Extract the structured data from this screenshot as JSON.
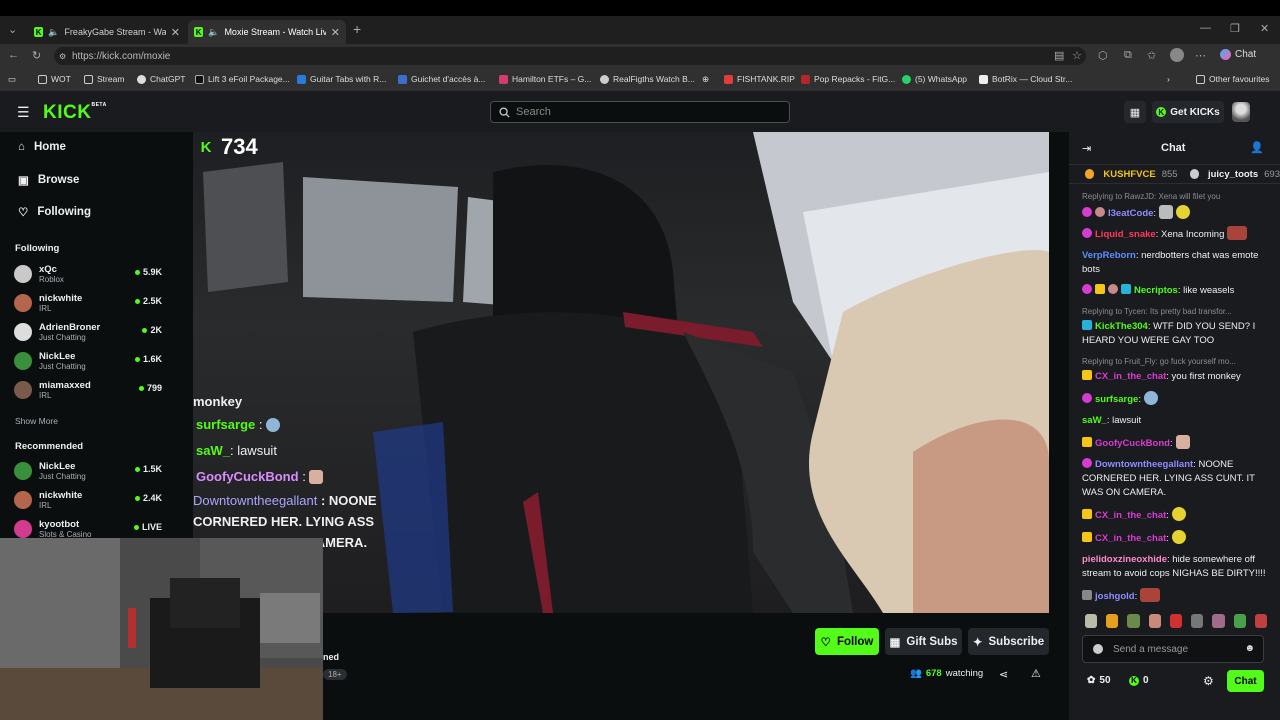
{
  "browser": {
    "tabs": [
      {
        "title": "FreakyGabe Stream - Watch L",
        "active": false
      },
      {
        "title": "Moxie Stream - Watch Live o",
        "active": true
      }
    ],
    "url": "https://kick.com/moxie",
    "assistant_label": "Chat",
    "bookmarks": [
      "WOT",
      "Stream",
      "ChatGPT",
      "Lift 3 eFoil Package...",
      "Guitar Tabs with R...",
      "Guichet d'accès à...",
      "Hamilton ETFs – G...",
      "RealFigths Watch B...",
      "FISHTANK.RIP",
      "Pop Repacks - FitG...",
      "(5) WhatsApp",
      "BotRix — Cloud Str..."
    ],
    "other_bookmarks": "Other favourites"
  },
  "header": {
    "logo": "KICK",
    "logo_badge": "BETA",
    "search_placeholder": "Search",
    "get_kicks": "Get KICKs"
  },
  "sidebar": {
    "nav": [
      "Home",
      "Browse",
      "Following"
    ],
    "following_title": "Following",
    "following": [
      {
        "name": "xQc",
        "category": "Roblox",
        "viewers": "5.9K",
        "color": "#c9c9c9"
      },
      {
        "name": "nickwhite",
        "category": "IRL",
        "viewers": "2.5K",
        "color": "#b5654b"
      },
      {
        "name": "AdrienBroner",
        "category": "Just Chatting",
        "viewers": "2K",
        "color": "#ddd"
      },
      {
        "name": "NickLee",
        "category": "Just Chatting",
        "viewers": "1.6K",
        "color": "#3a8f3a"
      },
      {
        "name": "miamaxxed",
        "category": "IRL",
        "viewers": "799",
        "color": "#7a5a4a"
      }
    ],
    "show_more": "Show More",
    "recommended_title": "Recommended",
    "recommended": [
      {
        "name": "NickLee",
        "category": "Just Chatting",
        "viewers": "1.5K",
        "color": "#3a8f3a"
      },
      {
        "name": "nickwhite",
        "category": "IRL",
        "viewers": "2.4K",
        "color": "#b5654b"
      },
      {
        "name": "kyootbot",
        "category": "Slots & Casino",
        "viewers": "LIVE",
        "color": "#d33b8e"
      }
    ]
  },
  "video": {
    "overlay_count": "734",
    "overlay_chat": [
      {
        "user": "",
        "text": "monkey"
      },
      {
        "user": "surfsarge",
        "text": ":"
      },
      {
        "user": "saW_",
        "text": ": lawsuit"
      },
      {
        "user": "GoofyCuckBond",
        "text": ":"
      },
      {
        "user": "Downtowntheegallant",
        "text": ": NOONE CORNERED HER. LYING ASS CUNT. IT WAS ON CAMERA."
      }
    ]
  },
  "below_video": {
    "follow": "Follow",
    "gift_subs": "Gift Subs",
    "subscribe": "Subscribe",
    "watching_count": "678",
    "watching_label": "watching",
    "partial_text": "ned",
    "partial_badge": "18+"
  },
  "chat": {
    "title": "Chat",
    "top_gifters": [
      {
        "name": "KUSHFVCE",
        "count": "855"
      },
      {
        "name": "juicy_toots",
        "count": "693"
      }
    ],
    "messages": [
      {
        "reply": "Replying to RawzJD: Xena will filet you",
        "user": "I3eatCode",
        "color": "#8f8cff",
        "text": "",
        "badge": "#d63ccf"
      },
      {
        "reply": "",
        "user": "Liquid_snake",
        "color": "#ff3a5c",
        "text": " Xena Incoming",
        "badge": "#d63ccf"
      },
      {
        "reply": "",
        "user": "VerpReborn",
        "color": "#5f8fff",
        "text": " nerdbotters chat was emote bots",
        "badge": ""
      },
      {
        "reply": "",
        "user": "Necriptos",
        "color": "#53fc18",
        "text": " like weasels",
        "badge": "#d63ccf"
      },
      {
        "reply": "Replying to Tycen: Its pretty bad transfor...",
        "user": "KickThe304",
        "color": "#53fc18",
        "text": " WTF DID YOU SEND? I HEARD YOU WERE GAY TOO",
        "badge": "#2ab1d9"
      },
      {
        "reply": "Replying to Fruit_Fly: go fuck yourself mo...",
        "user": "CX_in_the_chat",
        "color": "#d63ccf",
        "text": " you first monkey",
        "badge": "#f5c518"
      },
      {
        "reply": "",
        "user": "surfsarge",
        "color": "#53fc18",
        "text": "",
        "badge": "#d63ccf"
      },
      {
        "reply": "",
        "user": "saW_",
        "color": "#53fc18",
        "text": " lawsuit",
        "badge": ""
      },
      {
        "reply": "",
        "user": "GoofyCuckBond",
        "color": "#d63ccf",
        "text": "",
        "badge": "#f5c518"
      },
      {
        "reply": "",
        "user": "Downtowntheegallant",
        "color": "#8f8cff",
        "text": " NOONE CORNERED HER. LYING ASS CUNT. IT WAS ON CAMERA.",
        "badge": "#d63ccf"
      },
      {
        "reply": "",
        "user": "CX_in_the_chat",
        "color": "#d63ccf",
        "text": "",
        "badge": "#f5c518"
      },
      {
        "reply": "",
        "user": "CX_in_the_chat",
        "color": "#d63ccf",
        "text": "",
        "badge": "#f5c518"
      },
      {
        "reply": "",
        "user": "pielidoxzineoxhide",
        "color": "#ff8acb",
        "text": " hide somewhere off stream to avoid cops NIGHAS BE DIRTY!!!!",
        "badge": ""
      },
      {
        "reply": "",
        "user": "joshgold",
        "color": "#8f8cff",
        "text": "",
        "badge": "#888"
      }
    ],
    "send_placeholder": "Send a message",
    "points": "50",
    "kicks": "0",
    "chat_button": "Chat"
  }
}
